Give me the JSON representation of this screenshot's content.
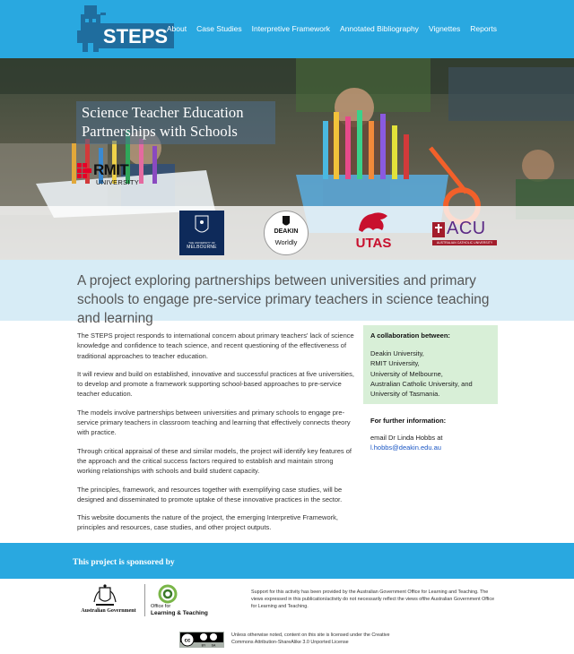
{
  "brand": {
    "logo_text": "STEPS",
    "accent": "#29a8e0"
  },
  "nav": {
    "items": [
      {
        "label": "About"
      },
      {
        "label": "Case Studies"
      },
      {
        "label": "Interpretive Framework"
      },
      {
        "label": "Annotated Bibliography"
      },
      {
        "label": "Vignettes"
      },
      {
        "label": "Reports"
      }
    ]
  },
  "hero": {
    "title_line1": "Science Teacher Education",
    "title_line2": "Partnerships with Schools"
  },
  "partners": {
    "rmit_name": "RMIT",
    "rmit_sub": "UNIVERSITY",
    "melbourne_sub": "THE UNIVERSITY OF",
    "melbourne_name": "MELBOURNE",
    "deakin_name": "DEAKIN",
    "deakin_tag": "Worldly",
    "utas_name": "UTAS",
    "acu_name": "ACU",
    "acu_sub": "AUSTRALIAN CATHOLIC UNIVERSITY"
  },
  "tagline": "A project exploring partnerships between universities and primary schools to engage pre-service primary teachers in science teaching and learning",
  "body": {
    "paragraphs": [
      "The STEPS project responds to international concern about primary teachers' lack of science knowledge and confidence to teach science, and recent questioning of the effectiveness of traditional approaches to teacher education.",
      "It will review and build on established, innovative and successful practices at five universities, to develop and promote a framework supporting school-based approaches to pre-service teacher education.",
      "The models involve partnerships between universities and primary schools to engage pre-service primary teachers in classroom teaching and learning that effectively connects theory with practice.",
      "Through critical appraisal of these and similar models, the project will identify key features of the approach and the critical success factors required to establish and maintain strong working relationships with schools and build student capacity.",
      "The principles, framework, and resources together with exemplifying case studies, will be designed and disseminated to promote uptake of these innovative practices in the sector.",
      "This website documents the nature of the project, the emerging Interpretive Framework, principles and resources, case studies, and other project outputs."
    ]
  },
  "collaboration": {
    "heading": "A collaboration between:",
    "lines": [
      "Deakin University,",
      "RMIT University,",
      "University of Melbourne,",
      "Australian Catholic University, and",
      "University of Tasmania."
    ]
  },
  "contact": {
    "heading": "For further information:",
    "line": "email Dr Linda Hobbs at",
    "email": "l.hobbs@deakin.edu.au"
  },
  "sponsor": {
    "heading": "This project is sponsored by",
    "gov_name": "Australian Government",
    "olt_line1": "Office for",
    "olt_line2": "Learning & Teaching",
    "support_text": "Support for this activity has been provided by the Australian Government Office for Learning and Teaching. The views expressed in this publication/activity do not necessarily reflect the views ofthe Australian Government Office for Learning and Teaching."
  },
  "license": {
    "text": "Unless otherwise noted, content on this site is licensed under the Creative Commons Attribution-ShareAlike 3.0 Unported License"
  }
}
